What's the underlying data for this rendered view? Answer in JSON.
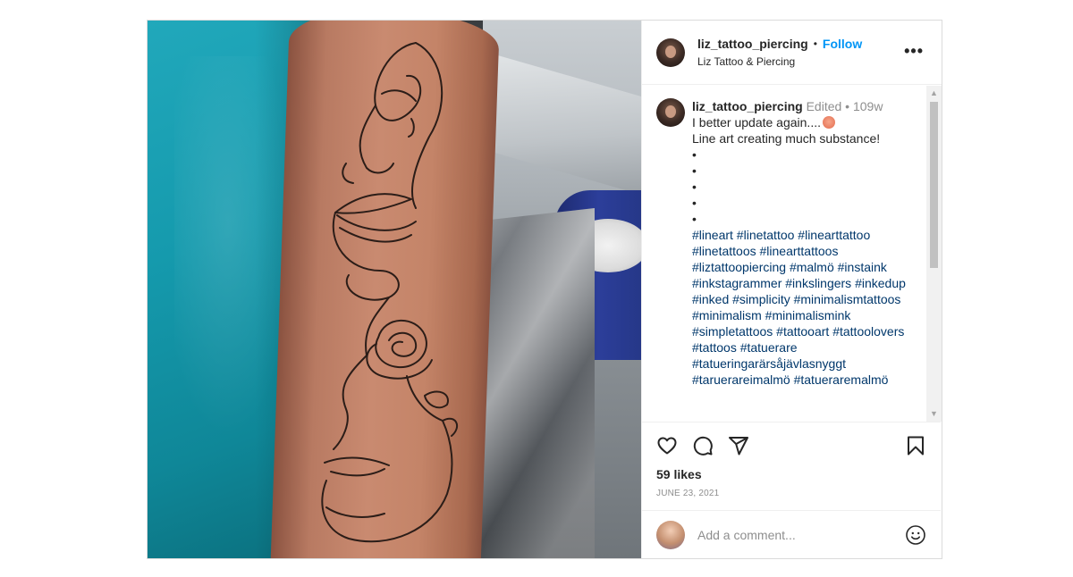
{
  "header": {
    "username": "liz_tattoo_piercing",
    "separator": "•",
    "follow_label": "Follow",
    "location": "Liz Tattoo & Piercing",
    "more_label": "•••"
  },
  "caption": {
    "username": "liz_tattoo_piercing",
    "edited": "Edited",
    "separator": "•",
    "age": "109w",
    "line1": "I better update again....",
    "line2": "Line art creating much substance!",
    "bullets": [
      "•",
      "•",
      "•",
      "•",
      "•"
    ],
    "hashtags": [
      "#lineart #linetattoo #linearttattoo",
      "#linetattoos #linearttattoos",
      "#liztattoopiercing #malmö #instaink",
      "#inkstagrammer #inkslingers #inkedup",
      "#inked #simplicity #minimalismtattoos",
      "#minimalism #minimalismink",
      "#simpletattoos #tattooart #tattoolovers",
      "#tattoos #tatuerare",
      "#tatueringarärsåjävlasnyggt",
      "#taruerareimalmö #tatueraremalmö"
    ]
  },
  "scrollbar": {
    "up": "▲",
    "down": "▼"
  },
  "actions": {
    "likes": "59 likes",
    "date": "JUNE 23, 2021"
  },
  "comment_box": {
    "placeholder": "Add a comment..."
  },
  "icons": {
    "like": "heart-icon",
    "comment": "comment-icon",
    "share": "share-icon",
    "save": "bookmark-icon",
    "emoji": "smile-icon",
    "more": "more-options-icon"
  },
  "colors": {
    "follow": "#0095f6",
    "hashtag": "#00376b",
    "meta": "#8e8e8e",
    "text": "#262626"
  }
}
